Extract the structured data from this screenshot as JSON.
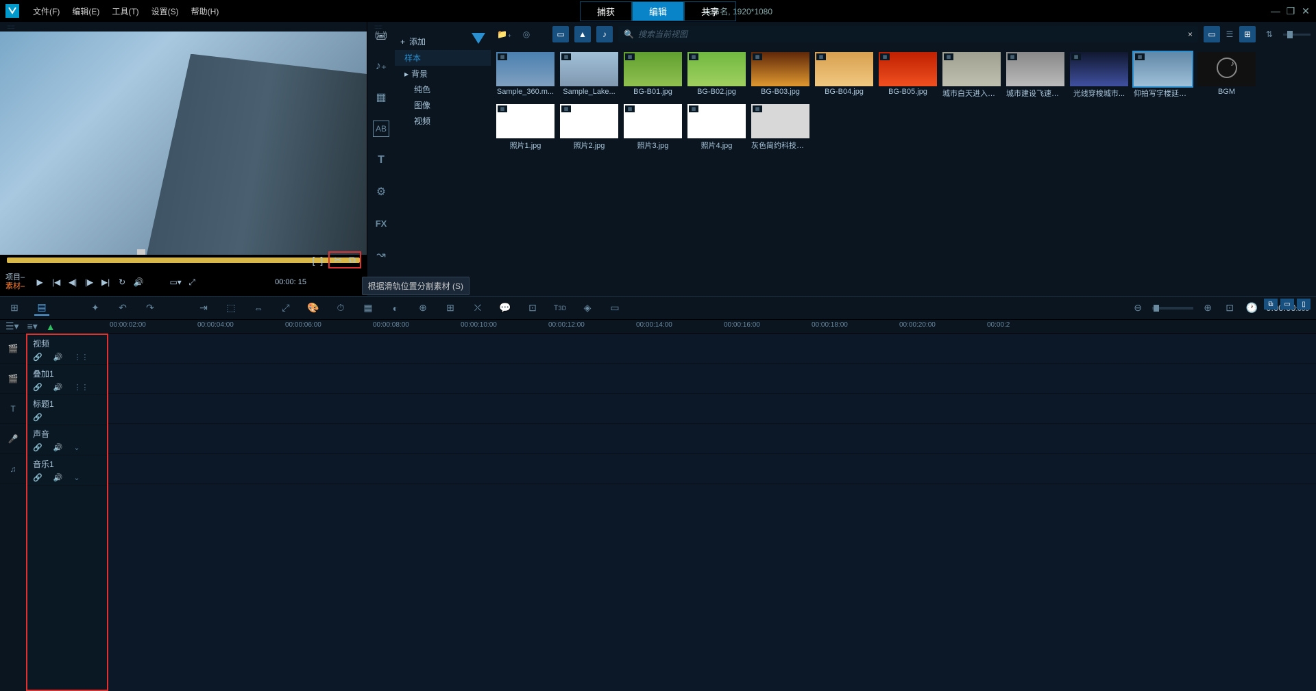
{
  "title_info": "未命名, 1920*1080",
  "menu": {
    "file": "文件(F)",
    "edit": "编辑(E)",
    "tool": "工具(T)",
    "setting": "设置(S)",
    "help": "帮助(H)"
  },
  "mode_tabs": {
    "capture": "捕获",
    "edit": "编辑",
    "share": "共享"
  },
  "preview": {
    "clip_label_project": "项目–",
    "clip_label_material": "素材–",
    "timecode_short": "00:00: 15",
    "tooltip": "根据滑轨位置分割素材 (S)"
  },
  "library": {
    "add": "添加",
    "tree": {
      "sample": "样本",
      "background": "背景",
      "solid": "纯色",
      "image": "图像",
      "video": "视频"
    },
    "search_placeholder": "搜索当前视图",
    "thumbs": [
      {
        "label": "Sample_360.m...",
        "type": "vid",
        "bg": "linear-gradient(#4a80b0,#80a0c0)"
      },
      {
        "label": "Sample_Lake...",
        "type": "vid",
        "bg": "linear-gradient(#a0c0d8,#8098b0)"
      },
      {
        "label": "BG-B01.jpg",
        "type": "img",
        "bg": "linear-gradient(#60a030,#90c050)"
      },
      {
        "label": "BG-B02.jpg",
        "type": "img",
        "bg": "linear-gradient(#70b840,#a0d060)"
      },
      {
        "label": "BG-B03.jpg",
        "type": "img",
        "bg": "linear-gradient(#602808,#e09830)"
      },
      {
        "label": "BG-B04.jpg",
        "type": "img",
        "bg": "linear-gradient(#d8a050,#f0c880)"
      },
      {
        "label": "BG-B05.jpg",
        "type": "img",
        "bg": "linear-gradient(#c02000,#f05020)"
      },
      {
        "label": "城市白天进入夜...",
        "type": "vid",
        "bg": "linear-gradient(#a0a090,#c0c0b0)"
      },
      {
        "label": "城市建设飞速崛...",
        "type": "vid",
        "bg": "linear-gradient(#888,#bbb)"
      },
      {
        "label": "光线穿梭城市...",
        "type": "vid",
        "bg": "linear-gradient(#101830,#4050a0)"
      },
      {
        "label": "仰拍写字楼延时...",
        "type": "vid",
        "bg": "linear-gradient(#6088a8,#a0c0d8)",
        "selected": true
      },
      {
        "label": "BGM",
        "type": "aud",
        "bg": "#111"
      },
      {
        "label": "照片1.jpg",
        "type": "img",
        "bg": "#fff"
      },
      {
        "label": "照片2.jpg",
        "type": "img",
        "bg": "#fff"
      },
      {
        "label": "照片3.jpg",
        "type": "img",
        "bg": "#fff"
      },
      {
        "label": "照片4.jpg",
        "type": "img",
        "bg": "#fff"
      },
      {
        "label": "灰色简约科技背...",
        "type": "vid",
        "bg": "#d8d8d8"
      }
    ]
  },
  "timeline": {
    "timecode": "0:00:00",
    "timecode_ms": ":000",
    "ticks": [
      "00:00:02:00",
      "00:00:04:00",
      "00:00:06:00",
      "00:00:08:00",
      "00:00:10:00",
      "00:00:12:00",
      "00:00:14:00",
      "00:00:16:00",
      "00:00:18:00",
      "00:00:20:00",
      "00:00:2"
    ],
    "tracks": [
      {
        "name": "视频",
        "icon": "🎬",
        "btns": [
          "🔗",
          "🔊",
          "⋮⋮"
        ]
      },
      {
        "name": "叠加1",
        "icon": "🎬",
        "btns": [
          "🔗",
          "🔊",
          "⋮⋮"
        ]
      },
      {
        "name": "标题1",
        "icon": "T",
        "btns": [
          "🔗"
        ]
      },
      {
        "name": "声音",
        "icon": "🎤",
        "btns": [
          "🔗",
          "🔊",
          "⌄"
        ]
      },
      {
        "name": "音乐1",
        "icon": "♫",
        "btns": [
          "🔗",
          "🔊",
          "⌄"
        ]
      }
    ]
  }
}
